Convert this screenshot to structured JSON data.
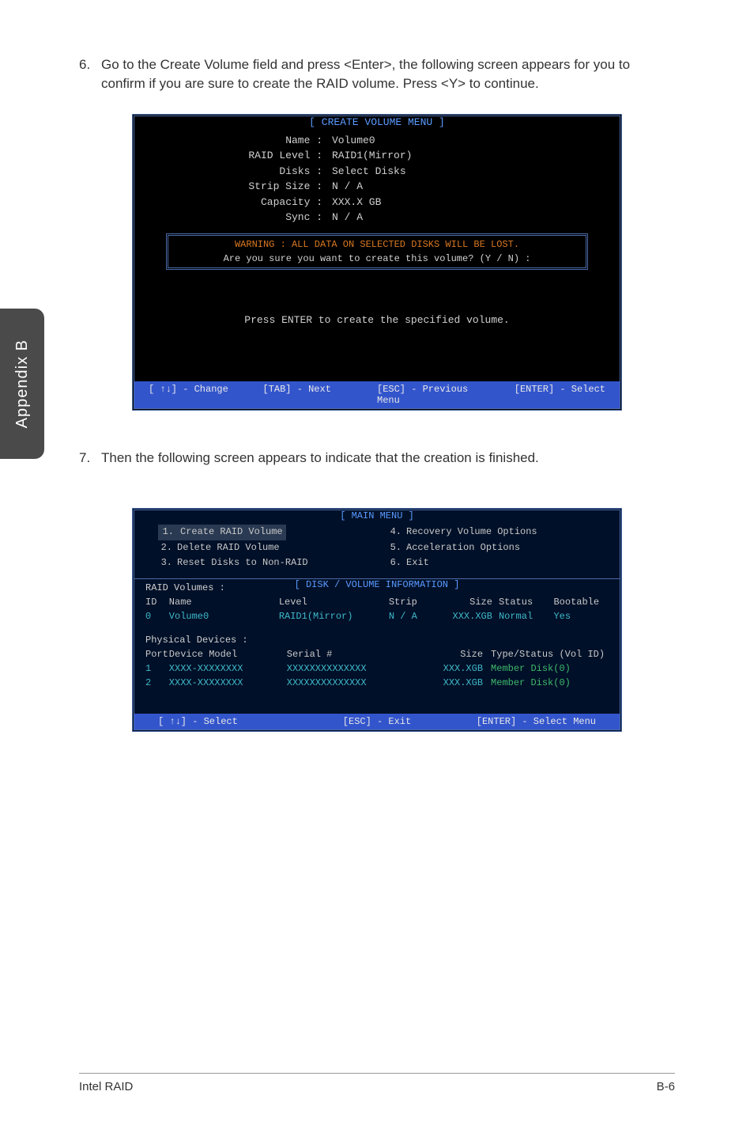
{
  "sidebar": {
    "label": "Appendix B"
  },
  "step6": {
    "num": "6.",
    "text": "Go to the Create Volume field and press <Enter>, the following screen appears for you to confirm if you are sure to create the RAID volume. Press <Y> to continue."
  },
  "createVolume": {
    "title": "[  CREATE VOLUME MENU  ]",
    "fields": {
      "name_label": "Name :",
      "name_value": "Volume0",
      "raid_label": "RAID Level :",
      "raid_value": "RAID1(Mirror)",
      "disks_label": "Disks :",
      "disks_value": "Select Disks",
      "strip_label": "Strip Size :",
      "strip_value": "N / A",
      "capacity_label": "Capacity :",
      "capacity_value": "XXX.X  GB",
      "sync_label": "Sync :",
      "sync_value": "N / A"
    },
    "warning": "WARNING :  ALL DATA ON SELECTED DISKS WILL BE LOST.",
    "confirm": "Are  you  sure  you  want  to  create  this  volume?  (Y / N)  :",
    "press_enter": "Press  ENTER  to  create  the  specified  volume.",
    "footer": {
      "change": "[ ↑↓] - Change",
      "tab": "[TAB] - Next",
      "esc": "[ESC] - Previous Menu",
      "enter": "[ENTER] - Select"
    }
  },
  "step7": {
    "num": "7.",
    "text": "Then the following screen appears to indicate that the creation is finished."
  },
  "mainMenu": {
    "title": "[   MAIN  MENU   ]",
    "items": {
      "i1_num": "1.",
      "i1_label": "Create  RAID  Volume",
      "i2_num": "2.",
      "i2_label": "Delete  RAID  Volume",
      "i3_num": "3.",
      "i3_label": "Reset Disks to Non-RAID",
      "i4_num": "4.",
      "i4_label": "Recovery Volume  Options",
      "i5_num": "5.",
      "i5_label": "Acceleration Options",
      "i6_num": "6.",
      "i6_label": "Exit"
    },
    "subTitle": "[   DISK / VOLUME INFORMATION   ]",
    "raidVolumesLabel": "RAID  Volumes :",
    "volHeaders": {
      "id": "ID",
      "name": "Name",
      "level": "Level",
      "strip": "Strip",
      "size": "Size",
      "status": "Status",
      "bootable": "Bootable"
    },
    "volRow": {
      "id": "0",
      "name": "Volume0",
      "level": "RAID1(Mirror)",
      "strip": "N / A",
      "size": "XXX.XGB",
      "status": "Normal",
      "bootable": "Yes"
    },
    "physDevicesLabel": "Physical  Devices :",
    "physHeaders": {
      "port": "Port",
      "model": "Device  Model",
      "serial": "Serial  #",
      "size": "Size",
      "type": "Type/Status (Vol  ID)"
    },
    "physRow1": {
      "port": "1",
      "model": "XXXX-XXXXXXXX",
      "serial": "XXXXXXXXXXXXXX",
      "size": "XXX.XGB",
      "type": "Member  Disk(0)"
    },
    "physRow2": {
      "port": "2",
      "model": "XXXX-XXXXXXXX",
      "serial": "XXXXXXXXXXXXXX",
      "size": "XXX.XGB",
      "type": "Member  Disk(0)"
    },
    "footer": {
      "select": "[ ↑↓] - Select",
      "esc": "[ESC] - Exit",
      "enter": "[ENTER] - Select Menu"
    }
  },
  "pageFooter": {
    "left": "Intel RAID",
    "right": "B-6"
  }
}
